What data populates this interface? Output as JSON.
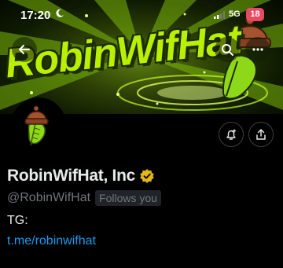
{
  "status_bar": {
    "time": "17:20",
    "network": "5G",
    "battery": "18"
  },
  "banner": {
    "title": "RobinWifHat"
  },
  "profile": {
    "display_name": "RobinWifHat, Inc",
    "handle": "@RobinWifHat",
    "follows_you": "Follows you",
    "bio_line": "TG:",
    "bio_link": "t.me/robinwifhat"
  },
  "colors": {
    "link": "#1d9bf0",
    "verified_gold": "#e2b719",
    "banner_green": "#b8f000",
    "battery_red": "#e84a64"
  },
  "icons": {
    "back": "back-arrow-icon",
    "search": "search-icon",
    "more": "more-horizontal-icon",
    "notify": "bell-plus-icon",
    "share": "share-icon",
    "verified": "verified-badge-icon"
  }
}
